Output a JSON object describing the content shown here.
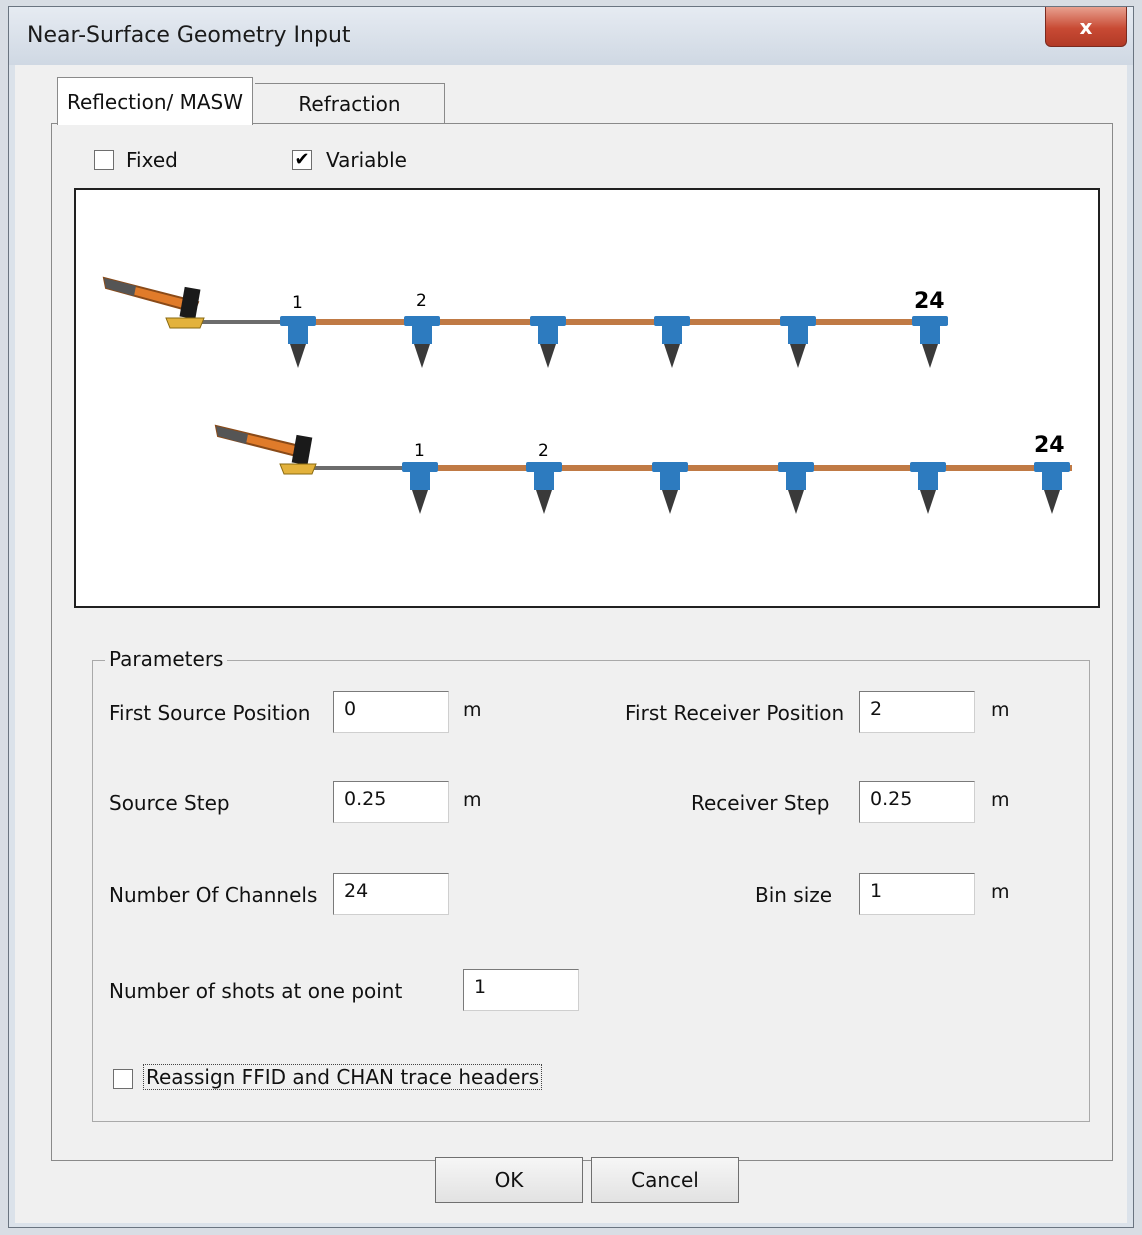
{
  "window": {
    "title": "Near-Surface Geometry Input",
    "close_glyph": "x"
  },
  "tabs": [
    {
      "label": "Reflection/ MASW",
      "active": true
    },
    {
      "label": "Refraction",
      "active": false
    }
  ],
  "mode": {
    "fixed": {
      "label": "Fixed",
      "checked": false
    },
    "variable": {
      "label": "Variable",
      "checked": true
    }
  },
  "diagram": {
    "row1": {
      "first_label": "1",
      "second_label": "2",
      "last_label": "24"
    },
    "row2": {
      "first_label": "1",
      "second_label": "2",
      "last_label": "24"
    },
    "colors": {
      "cable": "#c07a45",
      "geophone": "#2d7bbf",
      "hammer_handle": "#e07b2a",
      "hammer_head": "#1a1a1a"
    }
  },
  "parameters": {
    "title": "Parameters",
    "first_source_position": {
      "label": "First Source Position",
      "value": "0",
      "unit": "m"
    },
    "source_step": {
      "label": "Source Step",
      "value": "0.25",
      "unit": "m"
    },
    "number_of_channels": {
      "label": "Number Of Channels",
      "value": "24"
    },
    "first_receiver_position": {
      "label": "First Receiver Position",
      "value": "2",
      "unit": "m"
    },
    "receiver_step": {
      "label": "Receiver Step",
      "value": "0.25",
      "unit": "m"
    },
    "bin_size": {
      "label": "Bin size",
      "value": "1",
      "unit": "m"
    },
    "shots_per_point": {
      "label": "Number of shots at one point",
      "value": "1"
    },
    "reassign": {
      "label": "Reassign FFID and CHAN trace headers",
      "checked": false
    }
  },
  "buttons": {
    "ok": "OK",
    "cancel": "Cancel"
  }
}
